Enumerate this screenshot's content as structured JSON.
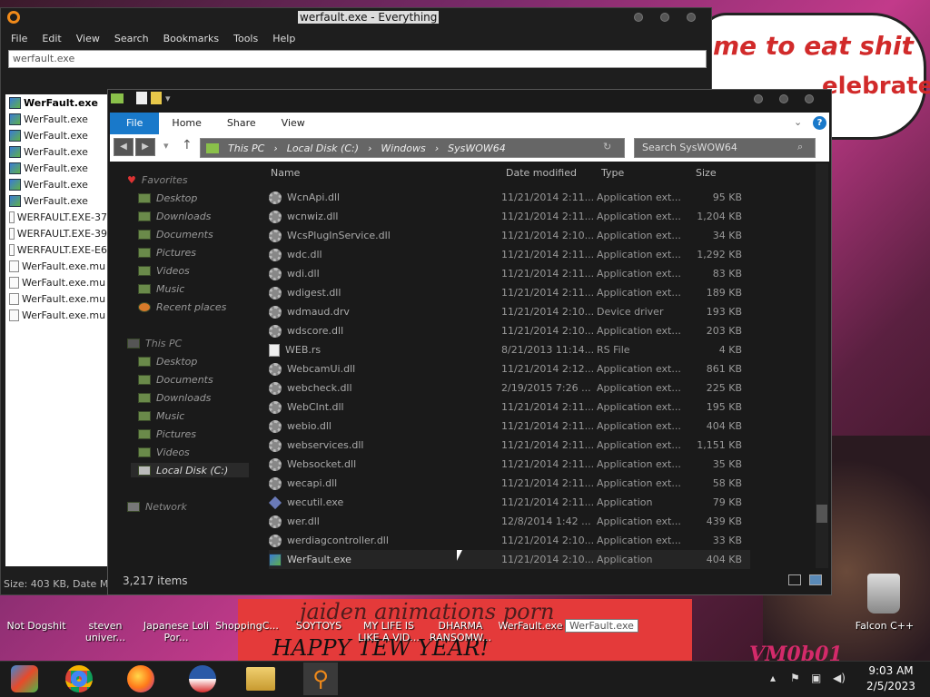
{
  "everything": {
    "title": "werfault.exe - Everything",
    "menu": [
      "File",
      "Edit",
      "View",
      "Search",
      "Bookmarks",
      "Tools",
      "Help"
    ],
    "search_value": "werfault.exe",
    "results": [
      "WerFault.exe",
      "WerFault.exe",
      "WerFault.exe",
      "WerFault.exe",
      "WerFault.exe",
      "WerFault.exe",
      "WerFault.exe",
      "WERFAULT.EXE-37",
      "WERFAULT.EXE-39",
      "WERFAULT.EXE-E6",
      "WerFault.exe.mu",
      "WerFault.exe.mu",
      "WerFault.exe.mu",
      "WerFault.exe.mu"
    ],
    "status": "Size: 403 KB, Date Mod"
  },
  "explorer": {
    "ribbon_tabs": [
      "File",
      "Home",
      "Share",
      "View"
    ],
    "help": "?",
    "address": [
      "This PC",
      "Local Disk (C:)",
      "Windows",
      "SysWOW64"
    ],
    "search_placeholder": "Search SysWOW64",
    "nav": {
      "favorites": "Favorites",
      "fav_items": [
        "Desktop",
        "Downloads",
        "Documents",
        "Pictures",
        "Videos",
        "Music",
        "Recent places"
      ],
      "thispc": "This PC",
      "pc_items": [
        "Desktop",
        "Documents",
        "Downloads",
        "Music",
        "Pictures",
        "Videos",
        "Local Disk (C:)"
      ],
      "network": "Network"
    },
    "columns": [
      "Name",
      "Date modified",
      "Type",
      "Size"
    ],
    "files": [
      {
        "icon": "gear",
        "name": "WcnApi.dll",
        "date": "11/21/2014 2:11...",
        "type": "Application ext...",
        "size": "95 KB"
      },
      {
        "icon": "gear",
        "name": "wcnwiz.dll",
        "date": "11/21/2014 2:11...",
        "type": "Application ext...",
        "size": "1,204 KB"
      },
      {
        "icon": "gear",
        "name": "WcsPlugInService.dll",
        "date": "11/21/2014 2:10...",
        "type": "Application ext...",
        "size": "34 KB"
      },
      {
        "icon": "gear",
        "name": "wdc.dll",
        "date": "11/21/2014 2:11...",
        "type": "Application ext...",
        "size": "1,292 KB"
      },
      {
        "icon": "gear",
        "name": "wdi.dll",
        "date": "11/21/2014 2:11...",
        "type": "Application ext...",
        "size": "83 KB"
      },
      {
        "icon": "gear",
        "name": "wdigest.dll",
        "date": "11/21/2014 2:11...",
        "type": "Application ext...",
        "size": "189 KB"
      },
      {
        "icon": "gear",
        "name": "wdmaud.drv",
        "date": "11/21/2014 2:10...",
        "type": "Device driver",
        "size": "193 KB"
      },
      {
        "icon": "gear",
        "name": "wdscore.dll",
        "date": "11/21/2014 2:10...",
        "type": "Application ext...",
        "size": "203 KB"
      },
      {
        "icon": "doc",
        "name": "WEB.rs",
        "date": "8/21/2013 11:14...",
        "type": "RS File",
        "size": "4 KB"
      },
      {
        "icon": "gear",
        "name": "WebcamUi.dll",
        "date": "11/21/2014 2:12...",
        "type": "Application ext...",
        "size": "861 KB"
      },
      {
        "icon": "gear",
        "name": "webcheck.dll",
        "date": "2/19/2015 7:26 ...",
        "type": "Application ext...",
        "size": "225 KB"
      },
      {
        "icon": "gear",
        "name": "WebClnt.dll",
        "date": "11/21/2014 2:11...",
        "type": "Application ext...",
        "size": "195 KB"
      },
      {
        "icon": "gear",
        "name": "webio.dll",
        "date": "11/21/2014 2:11...",
        "type": "Application ext...",
        "size": "404 KB"
      },
      {
        "icon": "gear",
        "name": "webservices.dll",
        "date": "11/21/2014 2:11...",
        "type": "Application ext...",
        "size": "1,151 KB"
      },
      {
        "icon": "gear",
        "name": "Websocket.dll",
        "date": "11/21/2014 2:11...",
        "type": "Application ext...",
        "size": "35 KB"
      },
      {
        "icon": "gear",
        "name": "wecapi.dll",
        "date": "11/21/2014 2:11...",
        "type": "Application ext...",
        "size": "58 KB"
      },
      {
        "icon": "diam",
        "name": "wecutil.exe",
        "date": "11/21/2014 2:11...",
        "type": "Application",
        "size": "79 KB"
      },
      {
        "icon": "gear",
        "name": "wer.dll",
        "date": "12/8/2014 1:42 ...",
        "type": "Application ext...",
        "size": "439 KB"
      },
      {
        "icon": "gear",
        "name": "werdiagcontroller.dll",
        "date": "11/21/2014 2:10...",
        "type": "Application ext...",
        "size": "33 KB"
      },
      {
        "icon": "exe",
        "name": "WerFault.exe",
        "date": "11/21/2014 2:10...",
        "type": "Application",
        "size": "404 KB"
      }
    ],
    "status": "3,217 items"
  },
  "desktop": {
    "bubble_text": "me to eat shit",
    "bubble_text2": "elebrate",
    "banner_top": "jaiden animations porn",
    "banner_text": "HAPPY TEW YEAR!",
    "vm_text": "VM0b01",
    "icons": [
      "Not Dogshit",
      "steven univer...",
      "Japanese Loli Por...",
      "ShoppingC...",
      "SOYTOYS",
      "MY LIFE IS LIKE A VID...",
      "DHARMA RANSOMW...",
      "WerFault.exe"
    ],
    "rename_value": "WerFault.exe",
    "trash_label": "Falcon C++"
  },
  "taskbar": {
    "time": "9:03 AM",
    "date": "2/5/2023"
  }
}
